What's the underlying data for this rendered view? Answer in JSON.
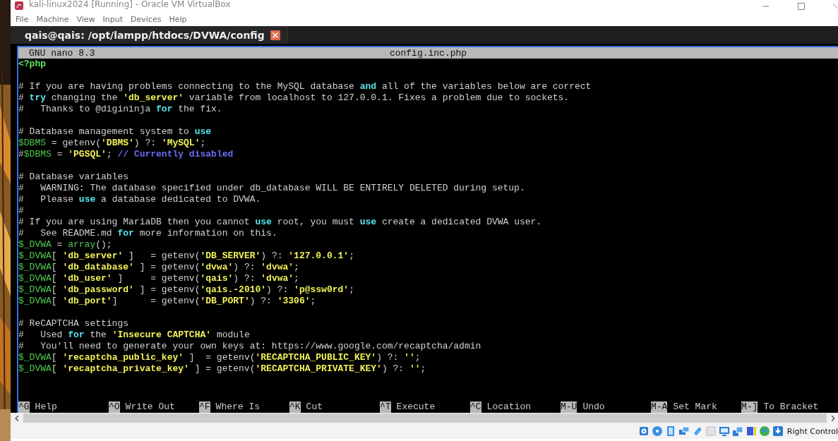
{
  "window": {
    "title": "kali-linux2024 [Running] - Oracle VM VirtualBox"
  },
  "menu": [
    "File",
    "Machine",
    "View",
    "Input",
    "Devices",
    "Help"
  ],
  "terminal_tab": {
    "title": "qais@qais: /opt/lampp/htdocs/DVWA/config"
  },
  "nano": {
    "version": "GNU nano 8.3",
    "filename": "config.inc.php",
    "lines": [
      {
        "kind": "code",
        "tokens": [
          {
            "kind": "tag",
            "text": "<?php"
          }
        ]
      },
      {
        "kind": "blank"
      },
      {
        "kind": "code",
        "tokens": [
          {
            "kind": "comment",
            "text": "# If you are having problems connecting to the MySQL database "
          },
          {
            "kind": "keyword",
            "text": "and"
          },
          {
            "kind": "comment",
            "text": " all of the variables below are correct"
          }
        ]
      },
      {
        "kind": "code",
        "tokens": [
          {
            "kind": "comment",
            "text": "# "
          },
          {
            "kind": "keyword",
            "text": "try"
          },
          {
            "kind": "comment",
            "text": " changing the "
          },
          {
            "kind": "string",
            "text": "'db_server'"
          },
          {
            "kind": "comment",
            "text": " variable from localhost to 127.0.0.1. Fixes a problem due to sockets."
          }
        ]
      },
      {
        "kind": "code",
        "tokens": [
          {
            "kind": "comment",
            "text": "#   Thanks to @digininja "
          },
          {
            "kind": "keyword",
            "text": "for"
          },
          {
            "kind": "comment",
            "text": " the fix."
          }
        ]
      },
      {
        "kind": "blank"
      },
      {
        "kind": "code",
        "tokens": [
          {
            "kind": "comment",
            "text": "# Database management system to "
          },
          {
            "kind": "keyword",
            "text": "use"
          }
        ]
      },
      {
        "kind": "code",
        "tokens": [
          {
            "kind": "variable",
            "text": "$DBMS"
          },
          {
            "kind": "plain",
            "text": " = getenv("
          },
          {
            "kind": "string",
            "text": "'DBMS'"
          },
          {
            "kind": "plain",
            "text": ") ?: "
          },
          {
            "kind": "string",
            "text": "'MySQL'"
          },
          {
            "kind": "plain",
            "text": ";"
          }
        ]
      },
      {
        "kind": "code",
        "tokens": [
          {
            "kind": "plain",
            "text": "#"
          },
          {
            "kind": "variable",
            "text": "$DBMS"
          },
          {
            "kind": "plain",
            "text": " = "
          },
          {
            "kind": "string",
            "text": "'PGSQL'"
          },
          {
            "kind": "plain",
            "text": "; "
          },
          {
            "kind": "note",
            "text": "// Currently disabled"
          }
        ]
      },
      {
        "kind": "blank"
      },
      {
        "kind": "code",
        "tokens": [
          {
            "kind": "comment",
            "text": "# Database variables"
          }
        ]
      },
      {
        "kind": "code",
        "tokens": [
          {
            "kind": "comment",
            "text": "#   WARNING: The database specified under db_database WILL BE ENTIRELY DELETED during setup."
          }
        ]
      },
      {
        "kind": "code",
        "tokens": [
          {
            "kind": "comment",
            "text": "#   Please "
          },
          {
            "kind": "keyword",
            "text": "use"
          },
          {
            "kind": "comment",
            "text": " a database dedicated to DVWA."
          }
        ]
      },
      {
        "kind": "code",
        "tokens": [
          {
            "kind": "comment",
            "text": "#"
          }
        ]
      },
      {
        "kind": "code",
        "tokens": [
          {
            "kind": "comment",
            "text": "# If you are using MariaDB then you cannot "
          },
          {
            "kind": "keyword",
            "text": "use"
          },
          {
            "kind": "comment",
            "text": " root, you must "
          },
          {
            "kind": "keyword",
            "text": "use"
          },
          {
            "kind": "comment",
            "text": " create a dedicated DVWA user."
          }
        ]
      },
      {
        "kind": "code",
        "tokens": [
          {
            "kind": "comment",
            "text": "#   See README.md "
          },
          {
            "kind": "keyword",
            "text": "for"
          },
          {
            "kind": "comment",
            "text": " more information on this."
          }
        ]
      },
      {
        "kind": "code",
        "tokens": [
          {
            "kind": "variable",
            "text": "$_DVWA"
          },
          {
            "kind": "plain",
            "text": " = "
          },
          {
            "kind": "function",
            "text": "array"
          },
          {
            "kind": "plain",
            "text": "();"
          }
        ]
      },
      {
        "kind": "code",
        "tokens": [
          {
            "kind": "variable",
            "text": "$_DVWA"
          },
          {
            "kind": "plain",
            "text": "[ "
          },
          {
            "kind": "string",
            "text": "'db_server'"
          },
          {
            "kind": "plain",
            "text": " ]   = getenv("
          },
          {
            "kind": "string",
            "text": "'DB_SERVER'"
          },
          {
            "kind": "plain",
            "text": ") ?: "
          },
          {
            "kind": "string",
            "text": "'127.0.0.1'"
          },
          {
            "kind": "plain",
            "text": ";"
          }
        ]
      },
      {
        "kind": "code",
        "tokens": [
          {
            "kind": "variable",
            "text": "$_DVWA"
          },
          {
            "kind": "plain",
            "text": "[ "
          },
          {
            "kind": "string",
            "text": "'db_database'"
          },
          {
            "kind": "plain",
            "text": " ] = getenv("
          },
          {
            "kind": "string",
            "text": "'dvwa'"
          },
          {
            "kind": "plain",
            "text": ") ?: "
          },
          {
            "kind": "string",
            "text": "'dvwa'"
          },
          {
            "kind": "plain",
            "text": ";"
          }
        ]
      },
      {
        "kind": "code",
        "tokens": [
          {
            "kind": "variable",
            "text": "$_DVWA"
          },
          {
            "kind": "plain",
            "text": "[ "
          },
          {
            "kind": "string",
            "text": "'db_user'"
          },
          {
            "kind": "plain",
            "text": " ]     = getenv("
          },
          {
            "kind": "string",
            "text": "'qais'"
          },
          {
            "kind": "plain",
            "text": ") ?: "
          },
          {
            "kind": "string",
            "text": "'dvwa'"
          },
          {
            "kind": "plain",
            "text": ";"
          }
        ]
      },
      {
        "kind": "code",
        "tokens": [
          {
            "kind": "variable",
            "text": "$_DVWA"
          },
          {
            "kind": "plain",
            "text": "[ "
          },
          {
            "kind": "string",
            "text": "'db_password'"
          },
          {
            "kind": "plain",
            "text": " ] = getenv("
          },
          {
            "kind": "string",
            "text": "'qais.-2010'"
          },
          {
            "kind": "plain",
            "text": ") ?: "
          },
          {
            "kind": "string",
            "text": "'p@ssw0rd'"
          },
          {
            "kind": "plain",
            "text": ";"
          }
        ]
      },
      {
        "kind": "code",
        "tokens": [
          {
            "kind": "variable",
            "text": "$_DVWA"
          },
          {
            "kind": "plain",
            "text": "[ "
          },
          {
            "kind": "string",
            "text": "'db_port'"
          },
          {
            "kind": "plain",
            "text": "]      = getenv("
          },
          {
            "kind": "string",
            "text": "'DB_PORT'"
          },
          {
            "kind": "plain",
            "text": ") ?: "
          },
          {
            "kind": "string",
            "text": "'3306'"
          },
          {
            "kind": "plain",
            "text": ";"
          }
        ]
      },
      {
        "kind": "blank"
      },
      {
        "kind": "code",
        "tokens": [
          {
            "kind": "comment",
            "text": "# ReCAPTCHA settings"
          }
        ]
      },
      {
        "kind": "code",
        "tokens": [
          {
            "kind": "comment",
            "text": "#   Used "
          },
          {
            "kind": "keyword",
            "text": "for"
          },
          {
            "kind": "comment",
            "text": " the "
          },
          {
            "kind": "string",
            "text": "'Insecure CAPTCHA'"
          },
          {
            "kind": "comment",
            "text": " module"
          }
        ]
      },
      {
        "kind": "code",
        "tokens": [
          {
            "kind": "comment",
            "text": "#   You'll need to generate your own keys at: https://www.google.com/recaptcha/admin"
          }
        ]
      },
      {
        "kind": "code",
        "tokens": [
          {
            "kind": "variable",
            "text": "$_DVWA"
          },
          {
            "kind": "plain",
            "text": "[ "
          },
          {
            "kind": "string",
            "text": "'recaptcha_public_key'"
          },
          {
            "kind": "plain",
            "text": " ]  = getenv("
          },
          {
            "kind": "string",
            "text": "'RECAPTCHA_PUBLIC_KEY'"
          },
          {
            "kind": "plain",
            "text": ") ?: "
          },
          {
            "kind": "string",
            "text": "''"
          },
          {
            "kind": "plain",
            "text": ";"
          }
        ]
      },
      {
        "kind": "code",
        "tokens": [
          {
            "kind": "variable",
            "text": "$_DVWA"
          },
          {
            "kind": "plain",
            "text": "[ "
          },
          {
            "kind": "string",
            "text": "'recaptcha_private_key'"
          },
          {
            "kind": "plain",
            "text": " ] = getenv("
          },
          {
            "kind": "string",
            "text": "'RECAPTCHA_PRIVATE_KEY'"
          },
          {
            "kind": "plain",
            "text": ") ?: "
          },
          {
            "kind": "string",
            "text": "''"
          },
          {
            "kind": "plain",
            "text": ";"
          }
        ]
      }
    ],
    "shortcuts": [
      {
        "key": "^G",
        "label": "Help"
      },
      {
        "key": "^O",
        "label": "Write Out"
      },
      {
        "key": "^F",
        "label": "Where Is"
      },
      {
        "key": "^K",
        "label": "Cut"
      },
      {
        "key": "^T",
        "label": "Execute"
      },
      {
        "key": "^C",
        "label": "Location"
      },
      {
        "key": "M-U",
        "label": "Undo"
      },
      {
        "key": "M-A",
        "label": "Set Mark"
      },
      {
        "key": "M-]",
        "label": "To Bracket"
      }
    ]
  },
  "status_bar": {
    "host_key": "Right Control"
  }
}
